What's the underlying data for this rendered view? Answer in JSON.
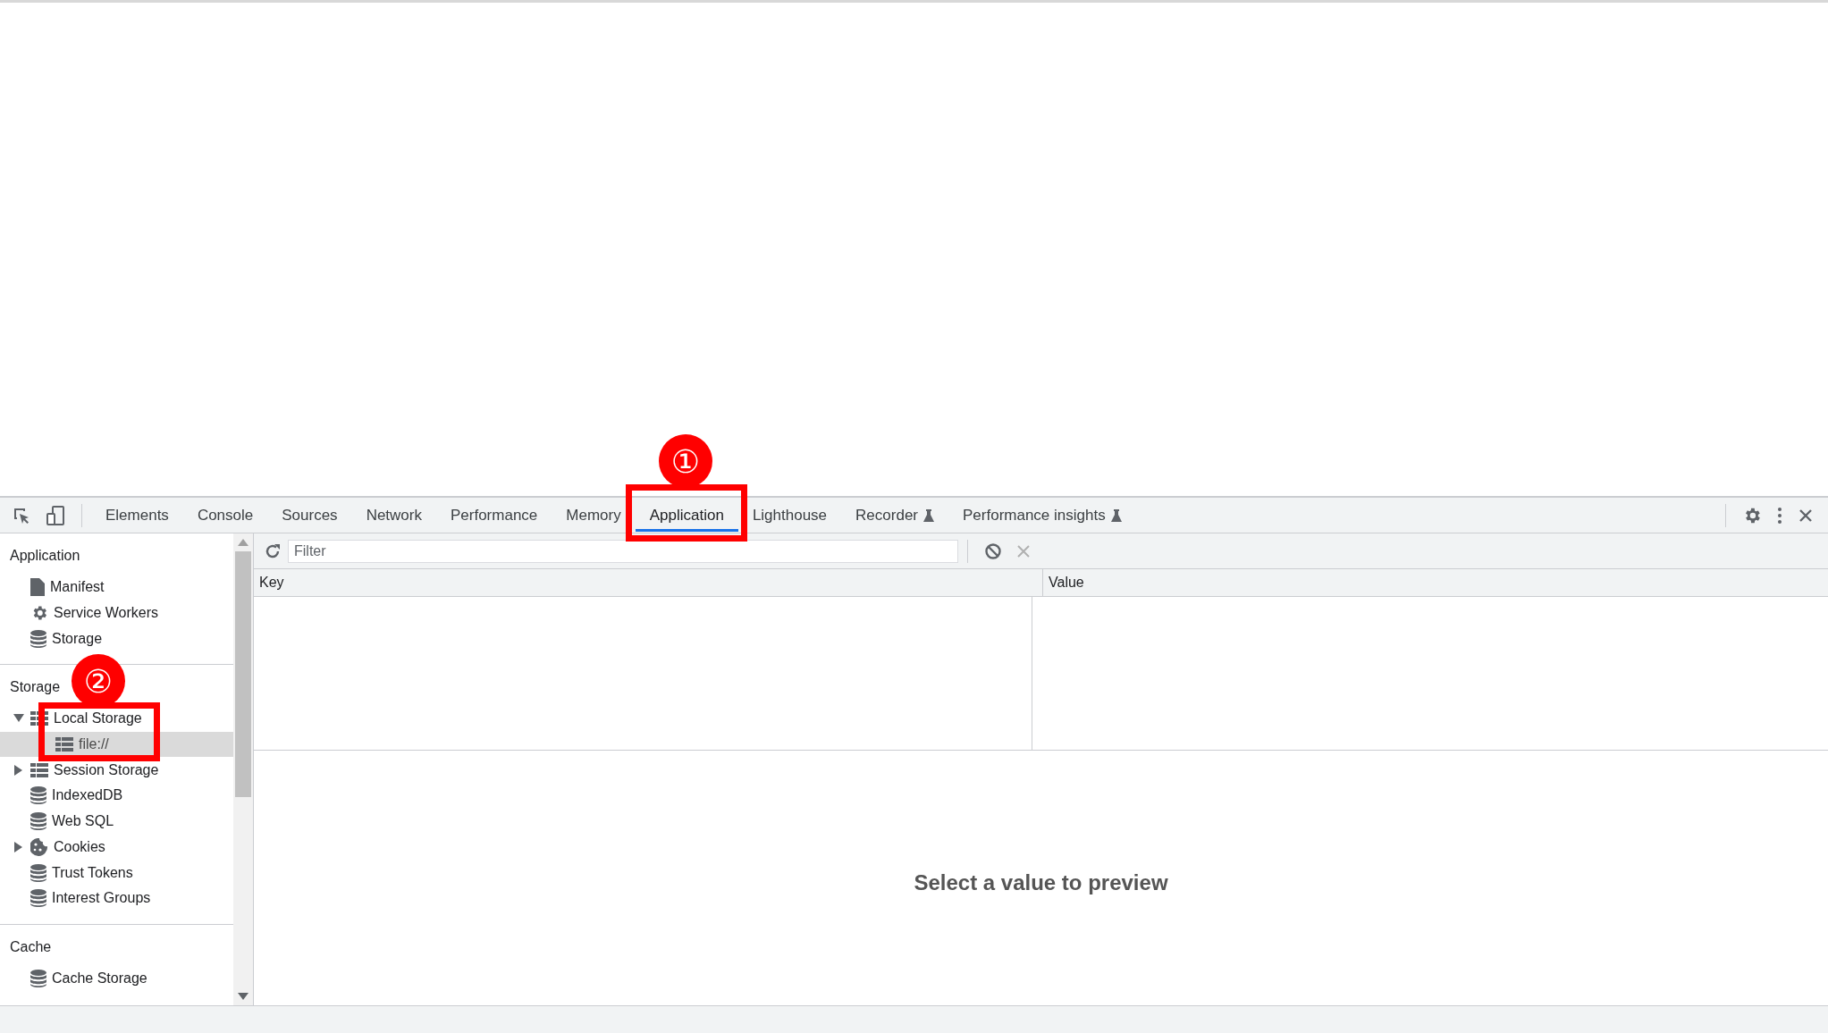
{
  "toolbar": {
    "tabs": [
      {
        "label": "Elements",
        "selected": false,
        "experimental": false
      },
      {
        "label": "Console",
        "selected": false,
        "experimental": false
      },
      {
        "label": "Sources",
        "selected": false,
        "experimental": false
      },
      {
        "label": "Network",
        "selected": false,
        "experimental": false
      },
      {
        "label": "Performance",
        "selected": false,
        "experimental": false
      },
      {
        "label": "Memory",
        "selected": false,
        "experimental": false
      },
      {
        "label": "Application",
        "selected": true,
        "experimental": false
      },
      {
        "label": "Lighthouse",
        "selected": false,
        "experimental": false
      },
      {
        "label": "Recorder",
        "selected": false,
        "experimental": true
      },
      {
        "label": "Performance insights",
        "selected": false,
        "experimental": true
      }
    ]
  },
  "sidebar": {
    "sections": [
      {
        "title": "Application",
        "items": [
          {
            "label": "Manifest",
            "kind": "file",
            "selected": false
          },
          {
            "label": "Service Workers",
            "kind": "gear",
            "selected": false
          },
          {
            "label": "Storage",
            "kind": "database",
            "selected": false
          }
        ]
      },
      {
        "title": "Storage",
        "items": [
          {
            "label": "Local Storage",
            "kind": "grid",
            "expanded": true,
            "selected": false,
            "children": [
              {
                "label": "file://",
                "kind": "grid",
                "selected": true
              }
            ]
          },
          {
            "label": "Session Storage",
            "kind": "grid",
            "expanded": false,
            "selected": false
          },
          {
            "label": "IndexedDB",
            "kind": "database",
            "selected": false
          },
          {
            "label": "Web SQL",
            "kind": "database",
            "selected": false
          },
          {
            "label": "Cookies",
            "kind": "cookie",
            "expanded": false,
            "selected": false
          },
          {
            "label": "Trust Tokens",
            "kind": "database",
            "selected": false
          },
          {
            "label": "Interest Groups",
            "kind": "database",
            "selected": false
          }
        ]
      },
      {
        "title": "Cache",
        "items": [
          {
            "label": "Cache Storage",
            "kind": "database",
            "selected": false
          }
        ]
      }
    ]
  },
  "filter": {
    "placeholder": "Filter"
  },
  "table": {
    "columns": [
      "Key",
      "Value"
    ]
  },
  "preview": {
    "message": "Select a value to preview"
  },
  "annotations": [
    {
      "label": "①"
    },
    {
      "label": "②"
    }
  ]
}
